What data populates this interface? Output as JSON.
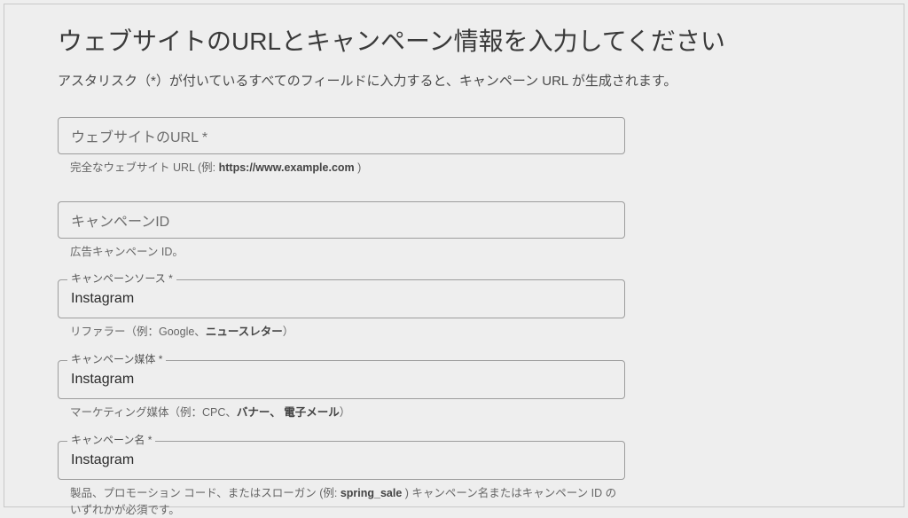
{
  "heading": "ウェブサイトのURLとキャンペーン情報を入力してください",
  "subheading": "アスタリスク（*）が付いているすべてのフィールドに入力すると、キャンペーン URL が生成されます。",
  "fields": {
    "website_url": {
      "placeholder": "ウェブサイトのURL *",
      "helper_pre": "完全なウェブサイト URL (例: ",
      "helper_bold": "https://www.example.com",
      "helper_post": " )"
    },
    "campaign_id": {
      "placeholder": "キャンペーンID",
      "helper": "広告キャンペーン ID。"
    },
    "campaign_source": {
      "label": "キャンペーンソース *",
      "value": "Instagram",
      "helper_pre": "リファラー（例：Google、",
      "helper_bold": "ニュースレター",
      "helper_post": "）"
    },
    "campaign_medium": {
      "label": "キャンペーン媒体 *",
      "value": "Instagram",
      "helper_pre": "マーケティング媒体（例：CPC、",
      "helper_b1": "バナー、",
      "helper_mid": " ",
      "helper_b2": "電子メール",
      "helper_post": "）"
    },
    "campaign_name": {
      "label": "キャンペーン名 *",
      "value": "Instagram",
      "helper_pre": "製品、プロモーション コード、またはスローガン (例: ",
      "helper_bold": "spring_sale",
      "helper_post": " ) キャンペーン名またはキャンペーン ID のいずれかが必須です。"
    }
  }
}
